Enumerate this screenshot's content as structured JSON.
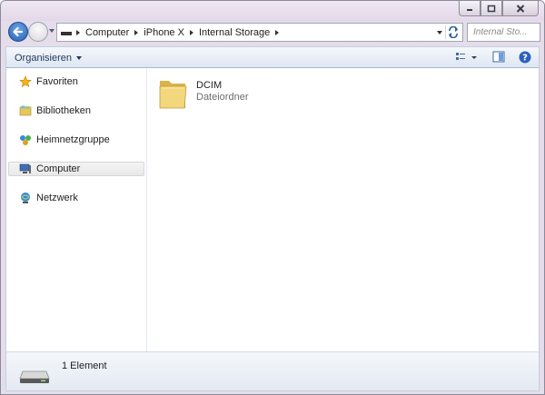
{
  "addressbar": {
    "crumbs": [
      "Computer",
      "iPhone X",
      "Internal Storage"
    ]
  },
  "search": {
    "placeholder": "Internal Sto..."
  },
  "toolbar": {
    "organize_label": "Organisieren"
  },
  "navpane": {
    "items": [
      {
        "label": "Favoriten",
        "icon": "star-icon"
      },
      {
        "label": "Bibliotheken",
        "icon": "libraries-icon"
      },
      {
        "label": "Heimnetzgruppe",
        "icon": "homegroup-icon"
      },
      {
        "label": "Computer",
        "icon": "computer-icon",
        "selected": true
      },
      {
        "label": "Netzwerk",
        "icon": "network-icon"
      }
    ]
  },
  "files": [
    {
      "name": "DCIM",
      "type": "Dateiordner",
      "icon": "folder-icon"
    }
  ],
  "status": {
    "count_text": "1 Element"
  },
  "colors": {
    "accent": "#1e395b",
    "selected_bg": "#ececec",
    "window_frame": "#e6ddea"
  }
}
